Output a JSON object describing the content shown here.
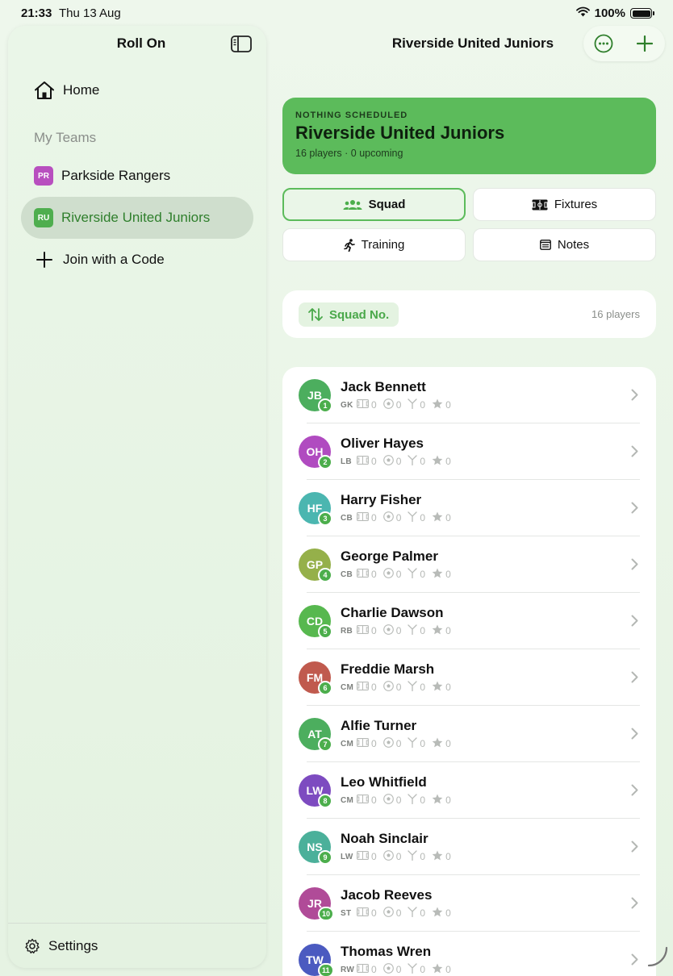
{
  "status": {
    "time": "21:33",
    "date": "Thu 13 Aug",
    "battery": "100%"
  },
  "sidebar": {
    "title": "Roll On",
    "home_label": "Home",
    "section_label": "My Teams",
    "teams": [
      {
        "initials": "PR",
        "name": "Parkside Rangers",
        "color": "#b84fbf"
      },
      {
        "initials": "RU",
        "name": "Riverside United Juniors",
        "color": "#4fae4f",
        "active": true
      }
    ],
    "join_label": "Join with a Code",
    "settings_label": "Settings"
  },
  "header": {
    "title": "Riverside United Juniors"
  },
  "hero": {
    "eyebrow": "NOTHING SCHEDULED",
    "title": "Riverside United Juniors",
    "subtitle": "16 players · 0 upcoming",
    "color": "#5cbb5b"
  },
  "tabs": [
    {
      "label": "Squad",
      "icon": "people-icon",
      "active": true
    },
    {
      "label": "Fixtures",
      "icon": "pitch-icon"
    },
    {
      "label": "Training",
      "icon": "running-icon"
    },
    {
      "label": "Notes",
      "icon": "notes-icon"
    }
  ],
  "sort": {
    "label": "Squad No.",
    "count": "16 players"
  },
  "players": [
    {
      "initials": "JB",
      "name": "Jack Bennett",
      "number": "1",
      "position": "GK",
      "color": "#4cae5e",
      "apps": "0",
      "goals": "0",
      "assists": "0",
      "motm": "0"
    },
    {
      "initials": "OH",
      "name": "Oliver Hayes",
      "number": "2",
      "position": "LB",
      "color": "#b04bc0",
      "apps": "0",
      "goals": "0",
      "assists": "0",
      "motm": "0"
    },
    {
      "initials": "HF",
      "name": "Harry Fisher",
      "number": "3",
      "position": "CB",
      "color": "#4bb6b0",
      "apps": "0",
      "goals": "0",
      "assists": "0",
      "motm": "0"
    },
    {
      "initials": "GP",
      "name": "George Palmer",
      "number": "4",
      "position": "CB",
      "color": "#95b04a",
      "apps": "0",
      "goals": "0",
      "assists": "0",
      "motm": "0"
    },
    {
      "initials": "CD",
      "name": "Charlie Dawson",
      "number": "5",
      "position": "RB",
      "color": "#57b84f",
      "apps": "0",
      "goals": "0",
      "assists": "0",
      "motm": "0"
    },
    {
      "initials": "FM",
      "name": "Freddie Marsh",
      "number": "6",
      "position": "CM",
      "color": "#c05a4e",
      "apps": "0",
      "goals": "0",
      "assists": "0",
      "motm": "0"
    },
    {
      "initials": "AT",
      "name": "Alfie Turner",
      "number": "7",
      "position": "CM",
      "color": "#4cae5e",
      "apps": "0",
      "goals": "0",
      "assists": "0",
      "motm": "0"
    },
    {
      "initials": "LW",
      "name": "Leo Whitfield",
      "number": "8",
      "position": "CM",
      "color": "#7d4bc0",
      "apps": "0",
      "goals": "0",
      "assists": "0",
      "motm": "0"
    },
    {
      "initials": "NS",
      "name": "Noah Sinclair",
      "number": "9",
      "position": "LW",
      "color": "#4bb09a",
      "apps": "0",
      "goals": "0",
      "assists": "0",
      "motm": "0"
    },
    {
      "initials": "JR",
      "name": "Jacob Reeves",
      "number": "10",
      "position": "ST",
      "color": "#b04b98",
      "apps": "0",
      "goals": "0",
      "assists": "0",
      "motm": "0"
    },
    {
      "initials": "TW",
      "name": "Thomas Wren",
      "number": "11",
      "position": "RW",
      "color": "#4b5ac0",
      "apps": "0",
      "goals": "0",
      "assists": "0",
      "motm": "0"
    }
  ]
}
